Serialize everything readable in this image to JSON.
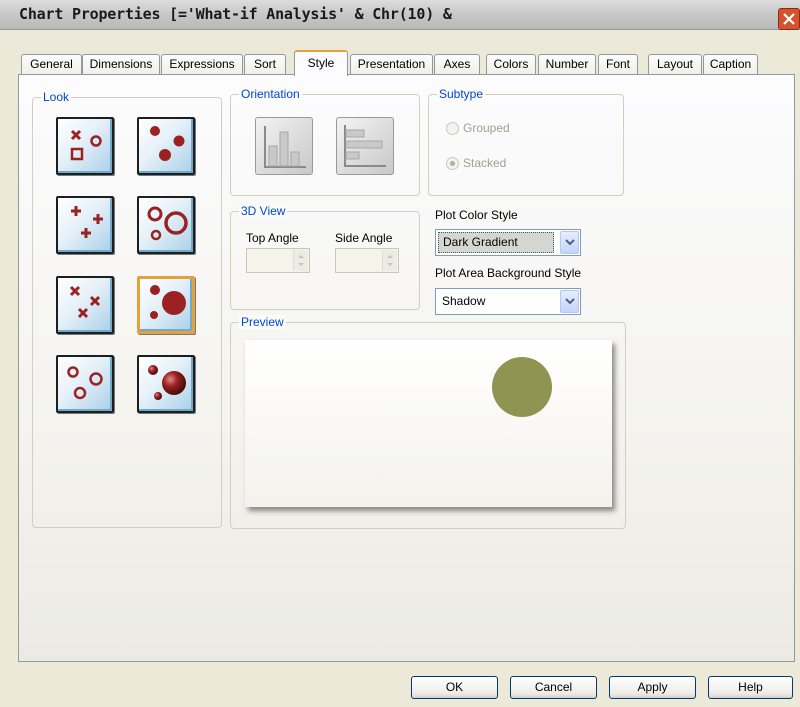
{
  "window": {
    "title": "Chart Properties [='What-if Analysis' & Chr(10) &"
  },
  "tabs": [
    {
      "label": "General"
    },
    {
      "label": "Dimensions"
    },
    {
      "label": "Expressions"
    },
    {
      "label": "Sort"
    },
    {
      "label": "Style",
      "active": true
    },
    {
      "label": "Presentation"
    },
    {
      "label": "Axes"
    },
    {
      "label": "Colors"
    },
    {
      "label": "Number"
    },
    {
      "label": "Font"
    },
    {
      "label": "Layout"
    },
    {
      "label": "Caption"
    }
  ],
  "look": {
    "label": "Look",
    "options": [
      {
        "icon": "scatter-mixed-symbols-icon"
      },
      {
        "icon": "scatter-filled-dots-icon"
      },
      {
        "icon": "scatter-plus-icon"
      },
      {
        "icon": "scatter-rings-icon"
      },
      {
        "icon": "scatter-cross-icon"
      },
      {
        "icon": "scatter-solid-bubbles-icon",
        "selected": true
      },
      {
        "icon": "scatter-small-rings-icon"
      },
      {
        "icon": "scatter-3d-bubbles-icon"
      }
    ]
  },
  "orientation": {
    "label": "Orientation",
    "vertical_icon": "vertical-bars-icon",
    "horizontal_icon": "horizontal-bars-icon"
  },
  "subtype": {
    "label": "Subtype",
    "grouped": "Grouped",
    "stacked": "Stacked",
    "selected": "Stacked"
  },
  "view3d": {
    "label": "3D View",
    "top_angle_label": "Top Angle",
    "side_angle_label": "Side Angle"
  },
  "plot_color_style": {
    "label": "Plot Color Style",
    "value": "Dark Gradient"
  },
  "plot_area_bg": {
    "label": "Plot Area Background Style",
    "value": "Shadow"
  },
  "preview": {
    "label": "Preview",
    "bubble_color": "#8f9450"
  },
  "buttons": {
    "ok": "OK",
    "cancel": "Cancel",
    "apply": "Apply",
    "help": "Help"
  },
  "colors": {
    "accent": "#e6a03c",
    "group_label": "#0046d5",
    "marker": "#9b2222",
    "close": "#d4532e"
  }
}
